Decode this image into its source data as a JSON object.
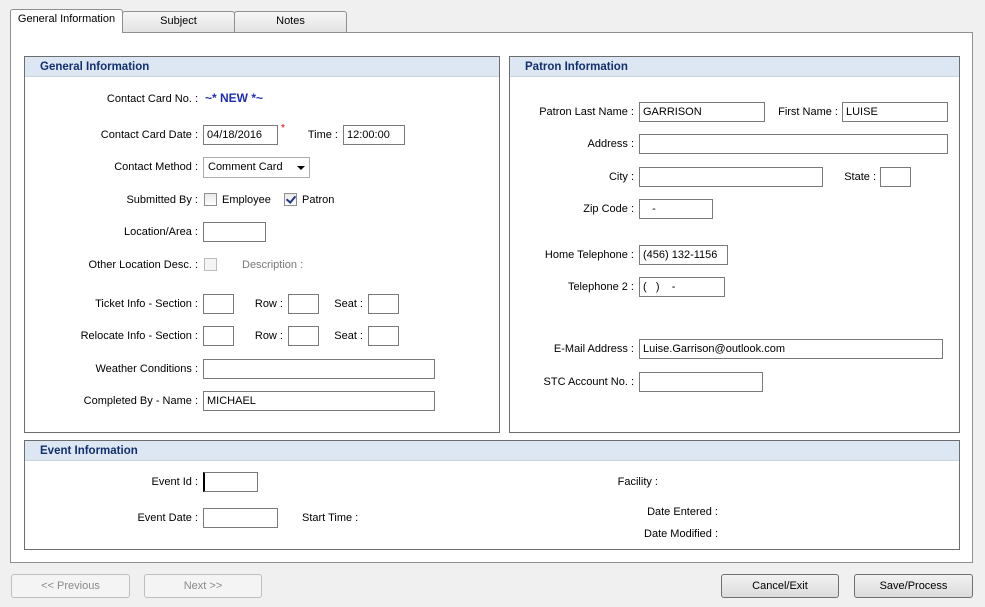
{
  "tabs": [
    "General Information",
    "Subject",
    "Notes"
  ],
  "general": {
    "header": "General Information",
    "contact_card_no_label": "Contact Card No. :",
    "contact_card_no_value": "~* NEW *~",
    "contact_card_date_label": "Contact Card Date :",
    "contact_card_date_value": "04/18/2016",
    "required_mark": "*",
    "time_label": "Time :",
    "time_value": "12:00:00",
    "contact_method_label": "Contact Method :",
    "contact_method_value": "Comment Card",
    "submitted_by_label": "Submitted By :",
    "employee_label": "Employee",
    "patron_label": "Patron",
    "location_label": "Location/Area :",
    "location_value": "",
    "other_location_label": "Other Location Desc. :",
    "description_label": "Description :",
    "ticket_info_label": "Ticket Info - Section :",
    "relocate_info_label": "Relocate Info - Section :",
    "row_label": "Row :",
    "seat_label": "Seat :",
    "weather_label": "Weather Conditions :",
    "weather_value": "",
    "completed_by_label": "Completed By - Name :",
    "completed_by_value": "MICHAEL"
  },
  "patron": {
    "header": "Patron Information",
    "last_name_label": "Patron Last Name :",
    "last_name_value": "GARRISON",
    "first_name_label": "First Name :",
    "first_name_value": "LUISE",
    "address_label": "Address :",
    "address_value": "",
    "city_label": "City :",
    "city_value": "",
    "state_label": "State :",
    "state_value": "",
    "zip_label": "Zip Code :",
    "zip_value": "   -",
    "home_phone_label": "Home Telephone :",
    "home_phone_value": "(456) 132-1156",
    "phone2_label": "Telephone 2 :",
    "phone2_value": "(   )    -",
    "email_label": "E-Mail Address :",
    "email_value": "Luise.Garrison@outlook.com",
    "stc_label": "STC Account No. :",
    "stc_value": ""
  },
  "event": {
    "header": "Event Information",
    "event_id_label": "Event Id :",
    "event_id_value": "",
    "event_date_label": "Event Date :",
    "event_date_value": "",
    "start_time_label": "Start Time :",
    "facility_label": "Facility :",
    "date_entered_label": "Date Entered :",
    "date_modified_label": "Date Modified :"
  },
  "buttons": {
    "previous": "<< Previous",
    "next": "Next >>",
    "cancel": "Cancel/Exit",
    "save": "Save/Process"
  }
}
